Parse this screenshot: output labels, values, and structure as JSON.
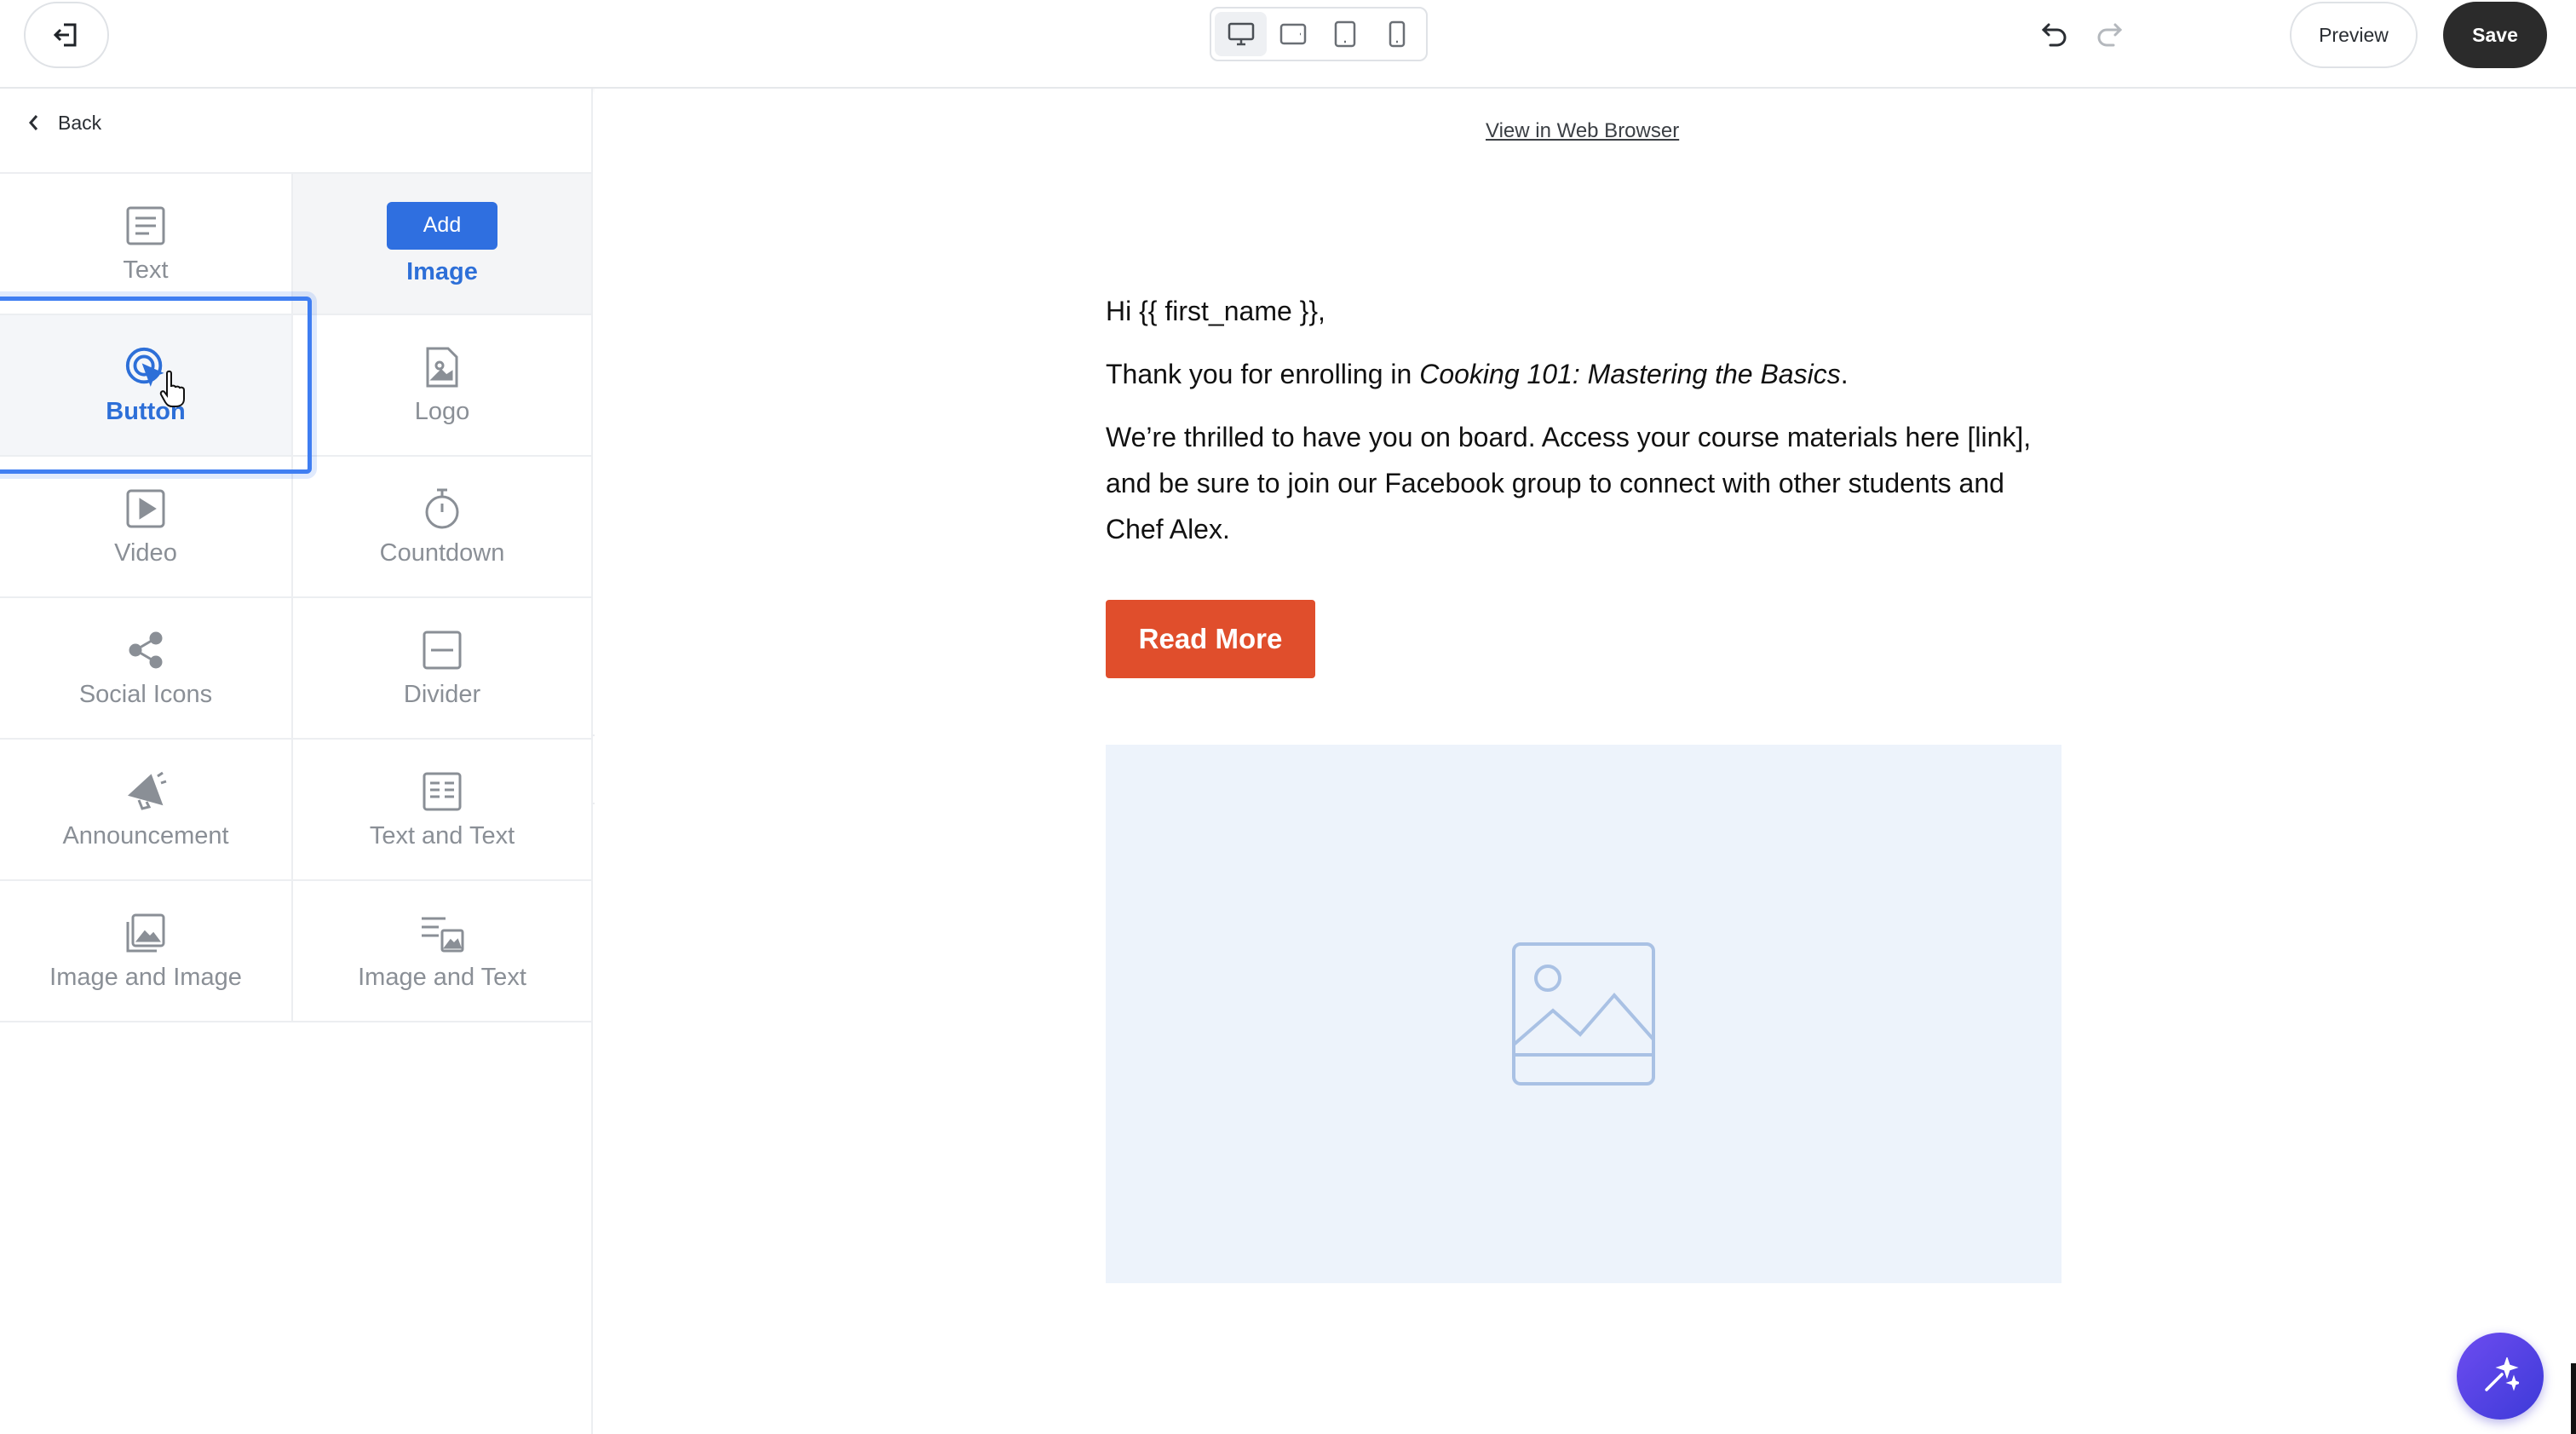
{
  "topbar": {
    "exit_icon": "exit-icon",
    "devices": [
      {
        "name": "desktop",
        "icon": "desktop-icon",
        "active": true
      },
      {
        "name": "tablet-landscape",
        "icon": "tablet-landscape-icon",
        "active": false
      },
      {
        "name": "tablet",
        "icon": "tablet-icon",
        "active": false
      },
      {
        "name": "mobile",
        "icon": "mobile-icon",
        "active": false
      }
    ],
    "undo_icon": "undo-icon",
    "redo_icon": "redo-icon",
    "preview_label": "Preview",
    "save_label": "Save"
  },
  "sidebar": {
    "back_label": "Back",
    "blocks": {
      "text": "Text",
      "image": "Image",
      "image_add": "Add",
      "button": "Button",
      "logo": "Logo",
      "video": "Video",
      "countdown": "Countdown",
      "social_icons": "Social Icons",
      "divider": "Divider",
      "announcement": "Announcement",
      "text_and_text": "Text and Text",
      "image_and_image": "Image and Image",
      "image_and_text": "Image and Text"
    }
  },
  "canvas": {
    "web_link": "View in Web Browser",
    "greeting": "Hi {{ first_name }},",
    "line1_prefix": "Thank you for enrolling in ",
    "line1_course": "Cooking 101: Mastering the Basics",
    "line1_suffix": ".",
    "paragraph": "We’re thrilled to have you on board. Access your course materials here [link], and be sure to join our Facebook group to connect with other students and Chef Alex.",
    "button_label": "Read More"
  },
  "colors": {
    "accent_blue": "#2f6fe0",
    "cta_orange": "#e04e2c",
    "save_dark": "#2b2b2b",
    "fab_purple": "#5a43e8"
  }
}
